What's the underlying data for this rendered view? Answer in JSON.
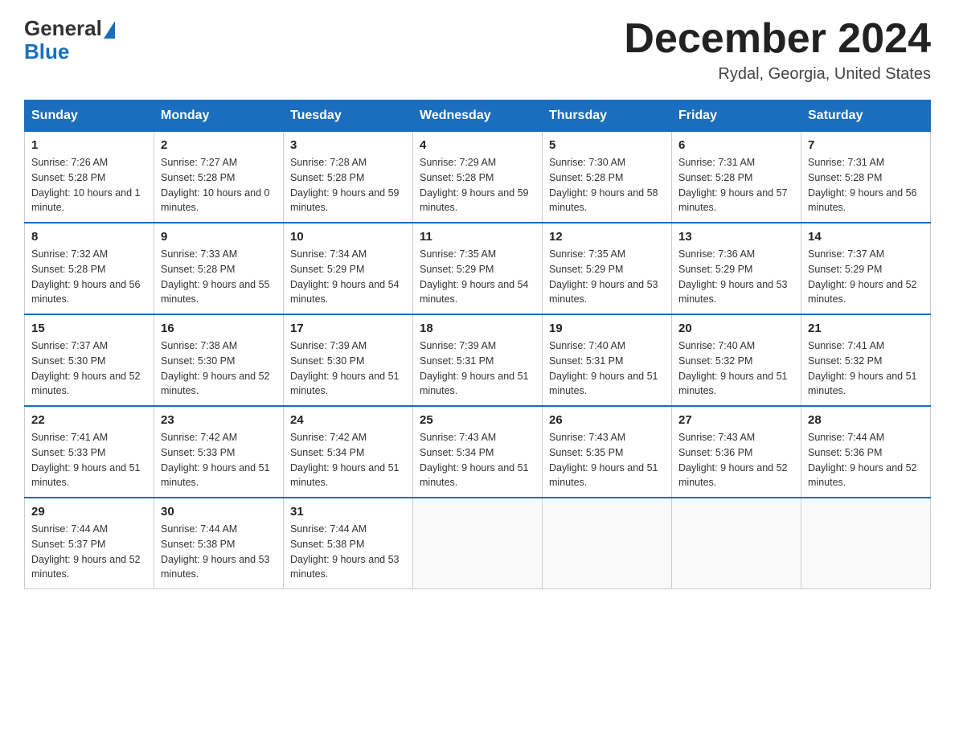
{
  "header": {
    "logo_general": "General",
    "logo_blue": "Blue",
    "month_title": "December 2024",
    "location": "Rydal, Georgia, United States"
  },
  "days_of_week": [
    "Sunday",
    "Monday",
    "Tuesday",
    "Wednesday",
    "Thursday",
    "Friday",
    "Saturday"
  ],
  "weeks": [
    [
      {
        "day": "1",
        "sunrise": "7:26 AM",
        "sunset": "5:28 PM",
        "daylight": "10 hours and 1 minute."
      },
      {
        "day": "2",
        "sunrise": "7:27 AM",
        "sunset": "5:28 PM",
        "daylight": "10 hours and 0 minutes."
      },
      {
        "day": "3",
        "sunrise": "7:28 AM",
        "sunset": "5:28 PM",
        "daylight": "9 hours and 59 minutes."
      },
      {
        "day": "4",
        "sunrise": "7:29 AM",
        "sunset": "5:28 PM",
        "daylight": "9 hours and 59 minutes."
      },
      {
        "day": "5",
        "sunrise": "7:30 AM",
        "sunset": "5:28 PM",
        "daylight": "9 hours and 58 minutes."
      },
      {
        "day": "6",
        "sunrise": "7:31 AM",
        "sunset": "5:28 PM",
        "daylight": "9 hours and 57 minutes."
      },
      {
        "day": "7",
        "sunrise": "7:31 AM",
        "sunset": "5:28 PM",
        "daylight": "9 hours and 56 minutes."
      }
    ],
    [
      {
        "day": "8",
        "sunrise": "7:32 AM",
        "sunset": "5:28 PM",
        "daylight": "9 hours and 56 minutes."
      },
      {
        "day": "9",
        "sunrise": "7:33 AM",
        "sunset": "5:28 PM",
        "daylight": "9 hours and 55 minutes."
      },
      {
        "day": "10",
        "sunrise": "7:34 AM",
        "sunset": "5:29 PM",
        "daylight": "9 hours and 54 minutes."
      },
      {
        "day": "11",
        "sunrise": "7:35 AM",
        "sunset": "5:29 PM",
        "daylight": "9 hours and 54 minutes."
      },
      {
        "day": "12",
        "sunrise": "7:35 AM",
        "sunset": "5:29 PM",
        "daylight": "9 hours and 53 minutes."
      },
      {
        "day": "13",
        "sunrise": "7:36 AM",
        "sunset": "5:29 PM",
        "daylight": "9 hours and 53 minutes."
      },
      {
        "day": "14",
        "sunrise": "7:37 AM",
        "sunset": "5:29 PM",
        "daylight": "9 hours and 52 minutes."
      }
    ],
    [
      {
        "day": "15",
        "sunrise": "7:37 AM",
        "sunset": "5:30 PM",
        "daylight": "9 hours and 52 minutes."
      },
      {
        "day": "16",
        "sunrise": "7:38 AM",
        "sunset": "5:30 PM",
        "daylight": "9 hours and 52 minutes."
      },
      {
        "day": "17",
        "sunrise": "7:39 AM",
        "sunset": "5:30 PM",
        "daylight": "9 hours and 51 minutes."
      },
      {
        "day": "18",
        "sunrise": "7:39 AM",
        "sunset": "5:31 PM",
        "daylight": "9 hours and 51 minutes."
      },
      {
        "day": "19",
        "sunrise": "7:40 AM",
        "sunset": "5:31 PM",
        "daylight": "9 hours and 51 minutes."
      },
      {
        "day": "20",
        "sunrise": "7:40 AM",
        "sunset": "5:32 PM",
        "daylight": "9 hours and 51 minutes."
      },
      {
        "day": "21",
        "sunrise": "7:41 AM",
        "sunset": "5:32 PM",
        "daylight": "9 hours and 51 minutes."
      }
    ],
    [
      {
        "day": "22",
        "sunrise": "7:41 AM",
        "sunset": "5:33 PM",
        "daylight": "9 hours and 51 minutes."
      },
      {
        "day": "23",
        "sunrise": "7:42 AM",
        "sunset": "5:33 PM",
        "daylight": "9 hours and 51 minutes."
      },
      {
        "day": "24",
        "sunrise": "7:42 AM",
        "sunset": "5:34 PM",
        "daylight": "9 hours and 51 minutes."
      },
      {
        "day": "25",
        "sunrise": "7:43 AM",
        "sunset": "5:34 PM",
        "daylight": "9 hours and 51 minutes."
      },
      {
        "day": "26",
        "sunrise": "7:43 AM",
        "sunset": "5:35 PM",
        "daylight": "9 hours and 51 minutes."
      },
      {
        "day": "27",
        "sunrise": "7:43 AM",
        "sunset": "5:36 PM",
        "daylight": "9 hours and 52 minutes."
      },
      {
        "day": "28",
        "sunrise": "7:44 AM",
        "sunset": "5:36 PM",
        "daylight": "9 hours and 52 minutes."
      }
    ],
    [
      {
        "day": "29",
        "sunrise": "7:44 AM",
        "sunset": "5:37 PM",
        "daylight": "9 hours and 52 minutes."
      },
      {
        "day": "30",
        "sunrise": "7:44 AM",
        "sunset": "5:38 PM",
        "daylight": "9 hours and 53 minutes."
      },
      {
        "day": "31",
        "sunrise": "7:44 AM",
        "sunset": "5:38 PM",
        "daylight": "9 hours and 53 minutes."
      },
      null,
      null,
      null,
      null
    ]
  ]
}
